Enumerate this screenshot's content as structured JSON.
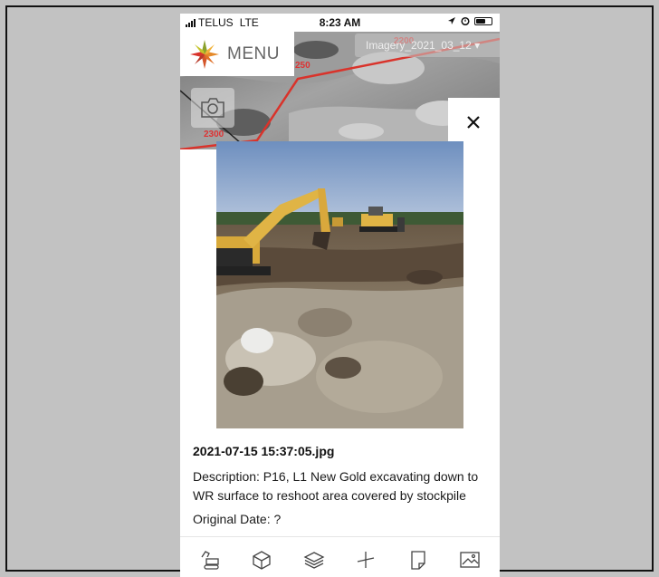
{
  "status_bar": {
    "carrier": "TELUS",
    "network": "LTE",
    "time": "8:23 AM"
  },
  "map": {
    "menu_label": "MENU",
    "imagery_select": "Imagery_2021_03_12",
    "station_labels": [
      "2200",
      "250",
      "2300"
    ],
    "route_color": "#d9332b"
  },
  "photo_panel": {
    "filename": "2021-07-15 15:37:05.jpg",
    "description": "Description: P16, L1 New Gold excavating down to WR surface to reshoot area covered by stockpile",
    "original_date": "Original Date: ?"
  },
  "toolbar": {
    "icons": [
      "excavator-icon",
      "cube-icon",
      "layers-icon",
      "measure-icon",
      "document-icon",
      "image-icon"
    ]
  }
}
